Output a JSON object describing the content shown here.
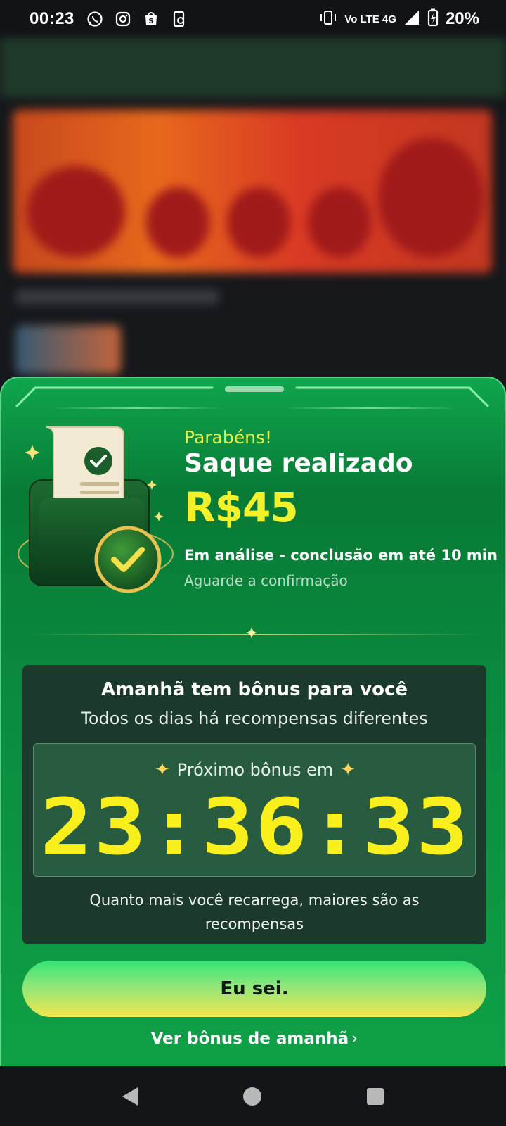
{
  "status_bar": {
    "time": "00:23",
    "network_label": "Vo LTE 4G",
    "battery": "20%",
    "icons": [
      "whatsapp-icon",
      "instagram-icon",
      "shopping-bag-icon",
      "phone-sync-icon",
      "vibrate-icon",
      "volte-icon",
      "signal-icon",
      "battery-charging-icon"
    ]
  },
  "sheet": {
    "congrats": "Parabéns!",
    "title": "Saque realizado",
    "amount": "R$45",
    "status_text": "Em análise - conclusão em até 10 min",
    "status_sub": "Aguarde a confirmação",
    "bonus": {
      "title": "Amanhã tem bônus para você",
      "subtitle": "Todos os dias há recompensas diferentes",
      "timer_label": "Próximo bônus em",
      "timer_value": "23:36:33",
      "note": "Quanto mais você recarrega, maiores são as recompensas"
    },
    "primary_button": "Eu sei.",
    "secondary_link": "Ver bônus de amanhã"
  },
  "colors": {
    "accent_yellow": "#f3f22a",
    "sheet_green": "#0a8a3e",
    "bonus_box": "#1b3a2b",
    "timer_box": "#275c40"
  }
}
